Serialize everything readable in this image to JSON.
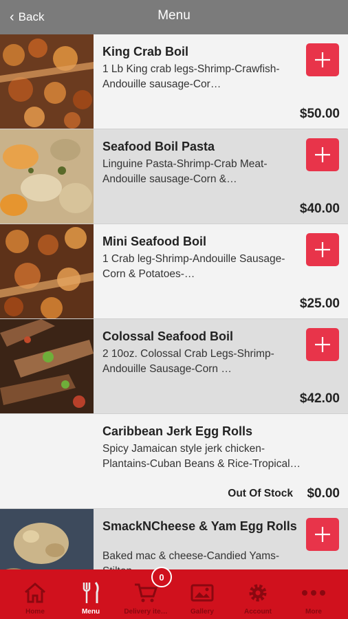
{
  "header": {
    "back_label": "Back",
    "title": "Menu"
  },
  "items": [
    {
      "name": "King Crab Boil",
      "description": "1 Lb King crab legs-Shrimp-Crawfish-Andouille sausage-Cor…",
      "price": "$50.00"
    },
    {
      "name": "Seafood Boil Pasta",
      "description": "Linguine Pasta-Shrimp-Crab Meat-Andouille sausage-Corn &…",
      "price": "$40.00"
    },
    {
      "name": "Mini Seafood Boil",
      "description": "1 Crab leg-Shrimp-Andouille Sausage-Corn & Potatoes-…",
      "price": "$25.00"
    },
    {
      "name": "Colossal Seafood Boil",
      "description": "2 10oz. Colossal Crab Legs-Shrimp-Andouille Sausage-Corn …",
      "price": "$42.00"
    },
    {
      "name": "Caribbean Jerk Egg Rolls",
      "description": "Spicy Jamaican style jerk chicken-Plantains-Cuban Beans & Rice-Tropical rum dipping…",
      "price": "$0.00",
      "status": "Out Of Stock"
    },
    {
      "name": "SmackNCheese & Yam Egg Rolls",
      "description": "Baked mac & cheese-Candied Yams-Stilton …",
      "price": ""
    }
  ],
  "tabbar": {
    "tabs": [
      {
        "label": "Home",
        "icon": "home-icon"
      },
      {
        "label": "Menu",
        "icon": "utensils-icon"
      },
      {
        "label": "Delivery ite…",
        "icon": "cart-icon"
      },
      {
        "label": "Gallery",
        "icon": "image-icon"
      },
      {
        "label": "Account",
        "icon": "gear-icon"
      },
      {
        "label": "More",
        "icon": "more-icon"
      }
    ],
    "cart_count": "0",
    "active": "Menu"
  },
  "colors": {
    "header_bg": "#7b7b7b",
    "tabbar_bg": "#d0111d",
    "add_button": "#e8344a",
    "row_light": "#f3f3f3",
    "row_dark": "#dedede"
  }
}
